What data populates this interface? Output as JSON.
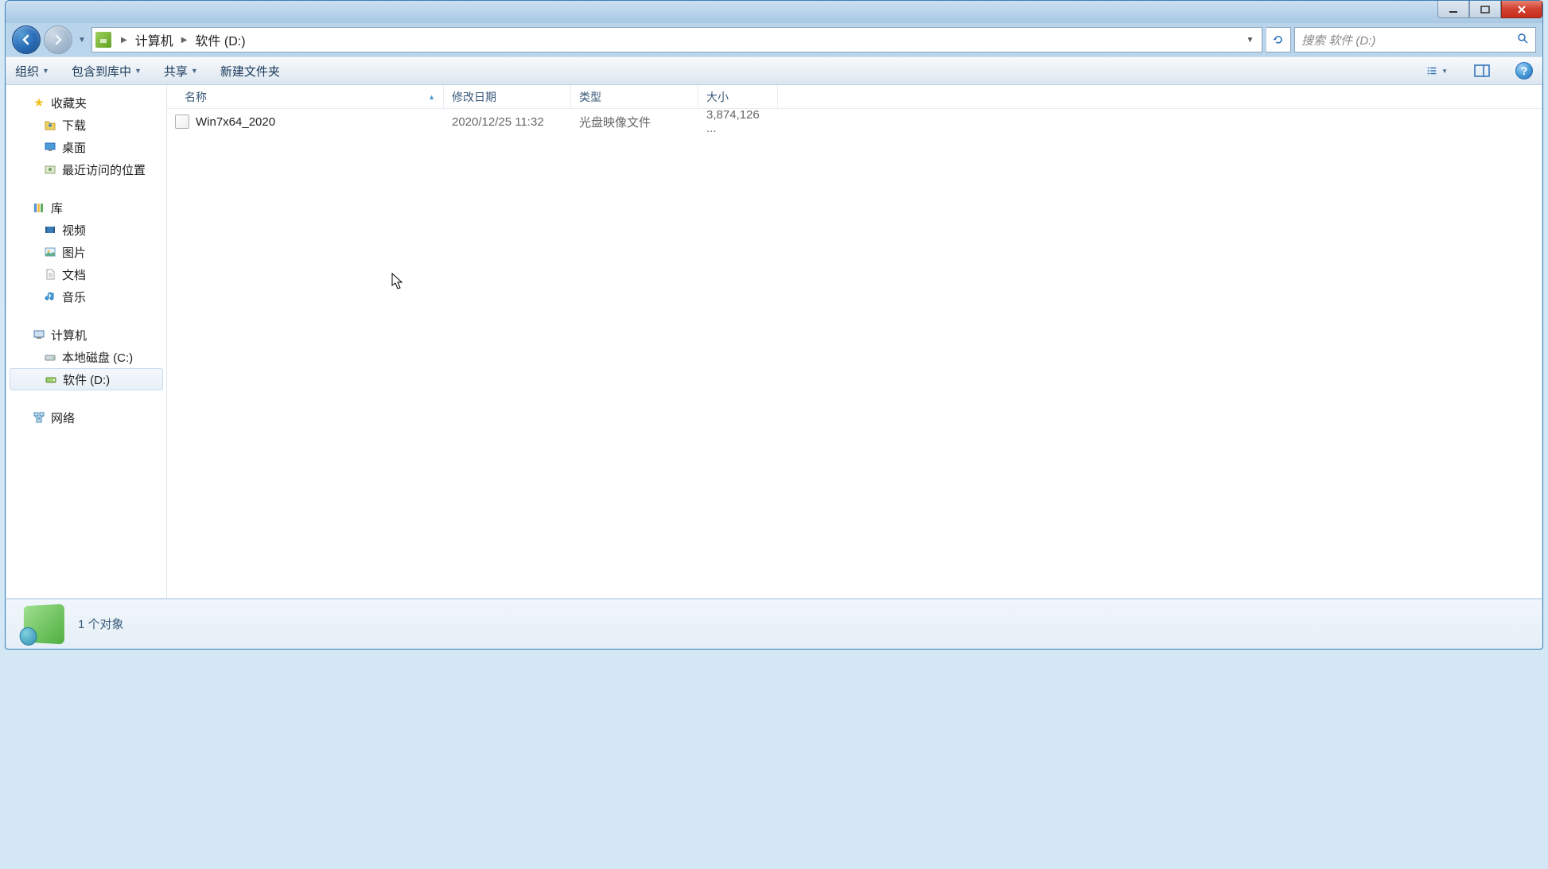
{
  "address": {
    "segments": [
      "计算机",
      "软件 (D:)"
    ],
    "search_placeholder": "搜索 软件 (D:)"
  },
  "toolbar": {
    "organize": "组织",
    "include_lib": "包含到库中",
    "share": "共享",
    "new_folder": "新建文件夹"
  },
  "sidebar": {
    "favorites": {
      "label": "收藏夹",
      "items": [
        {
          "icon": "download-icon",
          "label": "下载"
        },
        {
          "icon": "desktop-icon",
          "label": "桌面"
        },
        {
          "icon": "recent-icon",
          "label": "最近访问的位置"
        }
      ]
    },
    "libraries": {
      "label": "库",
      "items": [
        {
          "icon": "video-icon",
          "label": "视频"
        },
        {
          "icon": "picture-icon",
          "label": "图片"
        },
        {
          "icon": "document-icon",
          "label": "文档"
        },
        {
          "icon": "music-icon",
          "label": "音乐"
        }
      ]
    },
    "computer": {
      "label": "计算机",
      "items": [
        {
          "icon": "drive-icon",
          "label": "本地磁盘 (C:)"
        },
        {
          "icon": "drive-icon",
          "label": "软件 (D:)",
          "selected": true
        }
      ]
    },
    "network": {
      "label": "网络"
    }
  },
  "columns": {
    "name": "名称",
    "date": "修改日期",
    "type": "类型",
    "size": "大小"
  },
  "files": [
    {
      "name": "Win7x64_2020",
      "date": "2020/12/25 11:32",
      "type": "光盘映像文件",
      "size": "3,874,126 ..."
    }
  ],
  "status": {
    "text": "1 个对象"
  }
}
